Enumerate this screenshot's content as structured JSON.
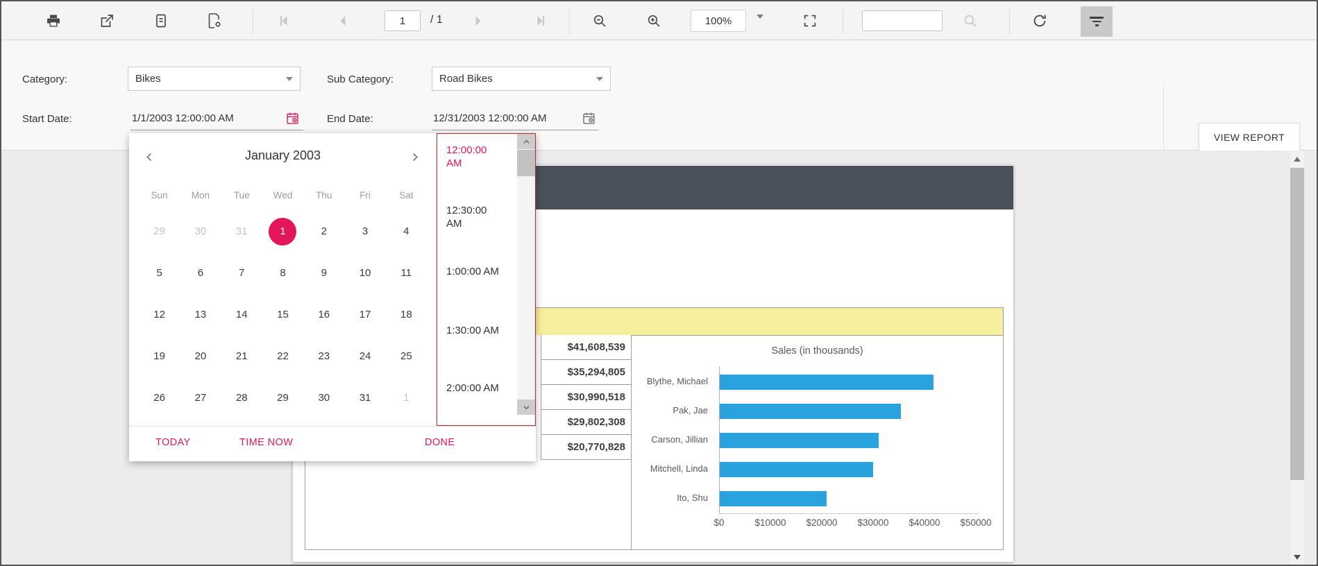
{
  "toolbar": {
    "page_current": "1",
    "page_total": "/ 1",
    "zoom_level": "100%",
    "search_value": "",
    "icons": [
      "print-icon",
      "export-icon",
      "report-body-icon",
      "page-setup-icon",
      "first-page-icon",
      "previous-page-icon",
      "next-page-icon",
      "last-page-icon",
      "zoom-out-icon",
      "zoom-in-icon",
      "fit-to-page-icon",
      "search-icon",
      "refresh-icon",
      "filter-parameters-icon"
    ]
  },
  "parameters": {
    "category": {
      "label": "Category:",
      "value": "Bikes"
    },
    "sub_category": {
      "label": "Sub Category:",
      "value": "Road Bikes"
    },
    "start_date": {
      "label": "Start Date:",
      "value": "1/1/2003 12:00:00 AM"
    },
    "end_date": {
      "label": "End Date:",
      "value": "12/31/2003 12:00:00 AM"
    },
    "view_report_label": "VIEW REPORT"
  },
  "datetime_picker": {
    "month_title": "January 2003",
    "weekdays": [
      "Sun",
      "Mon",
      "Tue",
      "Wed",
      "Thu",
      "Fri",
      "Sat"
    ],
    "days": [
      {
        "label": "29",
        "other": true
      },
      {
        "label": "30",
        "other": true
      },
      {
        "label": "31",
        "other": true
      },
      {
        "label": "1",
        "selected": true
      },
      {
        "label": "2"
      },
      {
        "label": "3"
      },
      {
        "label": "4"
      },
      {
        "label": "5"
      },
      {
        "label": "6"
      },
      {
        "label": "7"
      },
      {
        "label": "8"
      },
      {
        "label": "9"
      },
      {
        "label": "10"
      },
      {
        "label": "11"
      },
      {
        "label": "12"
      },
      {
        "label": "13"
      },
      {
        "label": "14"
      },
      {
        "label": "15"
      },
      {
        "label": "16"
      },
      {
        "label": "17"
      },
      {
        "label": "18"
      },
      {
        "label": "19"
      },
      {
        "label": "20"
      },
      {
        "label": "21"
      },
      {
        "label": "22"
      },
      {
        "label": "23"
      },
      {
        "label": "24"
      },
      {
        "label": "25"
      },
      {
        "label": "26"
      },
      {
        "label": "27"
      },
      {
        "label": "28"
      },
      {
        "label": "29"
      },
      {
        "label": "30"
      },
      {
        "label": "31"
      },
      {
        "label": "1",
        "other": true
      }
    ],
    "times": [
      {
        "label": "12:00:00 AM",
        "selected": true
      },
      {
        "label": "12:30:00 AM"
      },
      {
        "label": "1:00:00 AM"
      },
      {
        "label": "1:30:00 AM"
      },
      {
        "label": "2:00:00 AM"
      }
    ],
    "footer": {
      "today": "TODAY",
      "time_now": "TIME NOW",
      "done": "DONE"
    }
  },
  "report": {
    "table_values": [
      "$41,608,539",
      "$35,294,805",
      "$30,990,518",
      "$29,802,308",
      "$20,770,828"
    ]
  },
  "chart_data": {
    "type": "bar",
    "orientation": "horizontal",
    "title": "Sales (in thousands)",
    "categories": [
      "Blythe, Michael",
      "Pak, Jae",
      "Carson, Jillian",
      "Mitchell, Linda",
      "Ito, Shu"
    ],
    "values": [
      41608,
      35295,
      30991,
      29802,
      20771
    ],
    "x_ticks": [
      "$0",
      "$10000",
      "$20000",
      "$30000",
      "$40000",
      "$50000"
    ],
    "xlim": [
      0,
      50000
    ],
    "bar_color": "#2aa2de",
    "grid": false,
    "legend": false
  },
  "colors": {
    "accent_pink": "#e3165b",
    "time_panel_border": "#c12a2a",
    "report_header_bar": "#4a515a",
    "table_header_yellow": "#f5ef9e",
    "bar_blue": "#2aa2de"
  }
}
